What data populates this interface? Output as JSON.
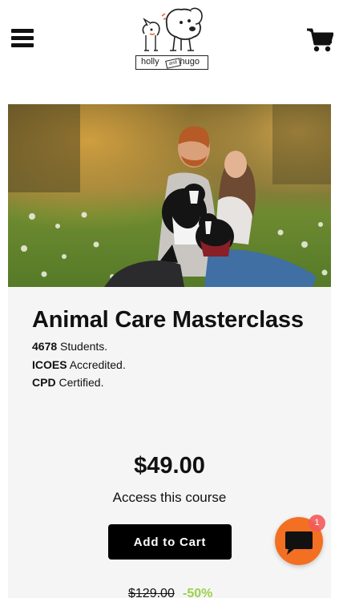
{
  "header": {
    "menu_icon": "hamburger-menu-icon",
    "logo": {
      "left_word": "holly",
      "middle_word": "and",
      "right_word": "hugo"
    },
    "cart_icon": "shopping-cart-icon"
  },
  "course": {
    "hero_image": "couple-with-border-collie-dogs-photo",
    "title": "Animal Care Masterclass",
    "stats": [
      {
        "strong": "4678",
        "text": " Students."
      },
      {
        "strong": "ICOES",
        "text": " Accredited."
      },
      {
        "strong": "CPD",
        "text": " Certified."
      }
    ],
    "price": "$49.00",
    "access_label": "Access this course",
    "add_to_cart_label": "Add to Cart",
    "old_price": "$129.00",
    "discount": "-50%"
  },
  "chat": {
    "icon": "chat-bubble-icon",
    "badge": "1",
    "colors": {
      "button": "#f36f21",
      "badge": "#f45b5b"
    }
  },
  "colors": {
    "discount": "#9bd14a",
    "button": "#000000"
  }
}
